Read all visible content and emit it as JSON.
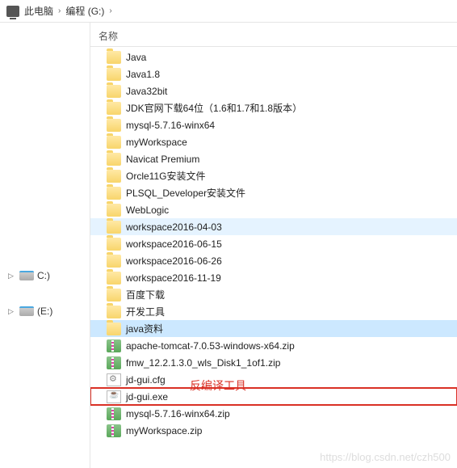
{
  "breadcrumb": {
    "items": [
      "此电脑",
      "编程 (G:)"
    ],
    "sep": "›"
  },
  "sidebar": {
    "drives": [
      {
        "label": "C:)"
      },
      {
        "label": "(E:)"
      }
    ]
  },
  "column_header": "名称",
  "annotation_text": "反编译工具",
  "watermark_text": "https://blog.csdn.net/czh500",
  "files": [
    {
      "name": "Java",
      "type": "folder"
    },
    {
      "name": "Java1.8",
      "type": "folder"
    },
    {
      "name": "Java32bit",
      "type": "folder"
    },
    {
      "name": "JDK官网下载64位（1.6和1.7和1.8版本）",
      "type": "folder"
    },
    {
      "name": "mysql-5.7.16-winx64",
      "type": "folder"
    },
    {
      "name": "myWorkspace",
      "type": "folder"
    },
    {
      "name": "Navicat Premium",
      "type": "folder"
    },
    {
      "name": "Orcle11G安装文件",
      "type": "folder"
    },
    {
      "name": "PLSQL_Developer安装文件",
      "type": "folder"
    },
    {
      "name": "WebLogic",
      "type": "folder"
    },
    {
      "name": "workspace2016-04-03",
      "type": "folder",
      "state": "highlighted"
    },
    {
      "name": "workspace2016-06-15",
      "type": "folder"
    },
    {
      "name": "workspace2016-06-26",
      "type": "folder"
    },
    {
      "name": "workspace2016-11-19",
      "type": "folder"
    },
    {
      "name": "百度下载",
      "type": "folder"
    },
    {
      "name": "开发工具",
      "type": "folder"
    },
    {
      "name": "java资料",
      "type": "folder",
      "state": "selected"
    },
    {
      "name": "apache-tomcat-7.0.53-windows-x64.zip",
      "type": "zip"
    },
    {
      "name": "fmw_12.2.1.3.0_wls_Disk1_1of1.zip",
      "type": "zip"
    },
    {
      "name": "jd-gui.cfg",
      "type": "cfg"
    },
    {
      "name": "jd-gui.exe",
      "type": "exe",
      "boxed": true
    },
    {
      "name": "mysql-5.7.16-winx64.zip",
      "type": "zip"
    },
    {
      "name": "myWorkspace.zip",
      "type": "zip"
    }
  ]
}
